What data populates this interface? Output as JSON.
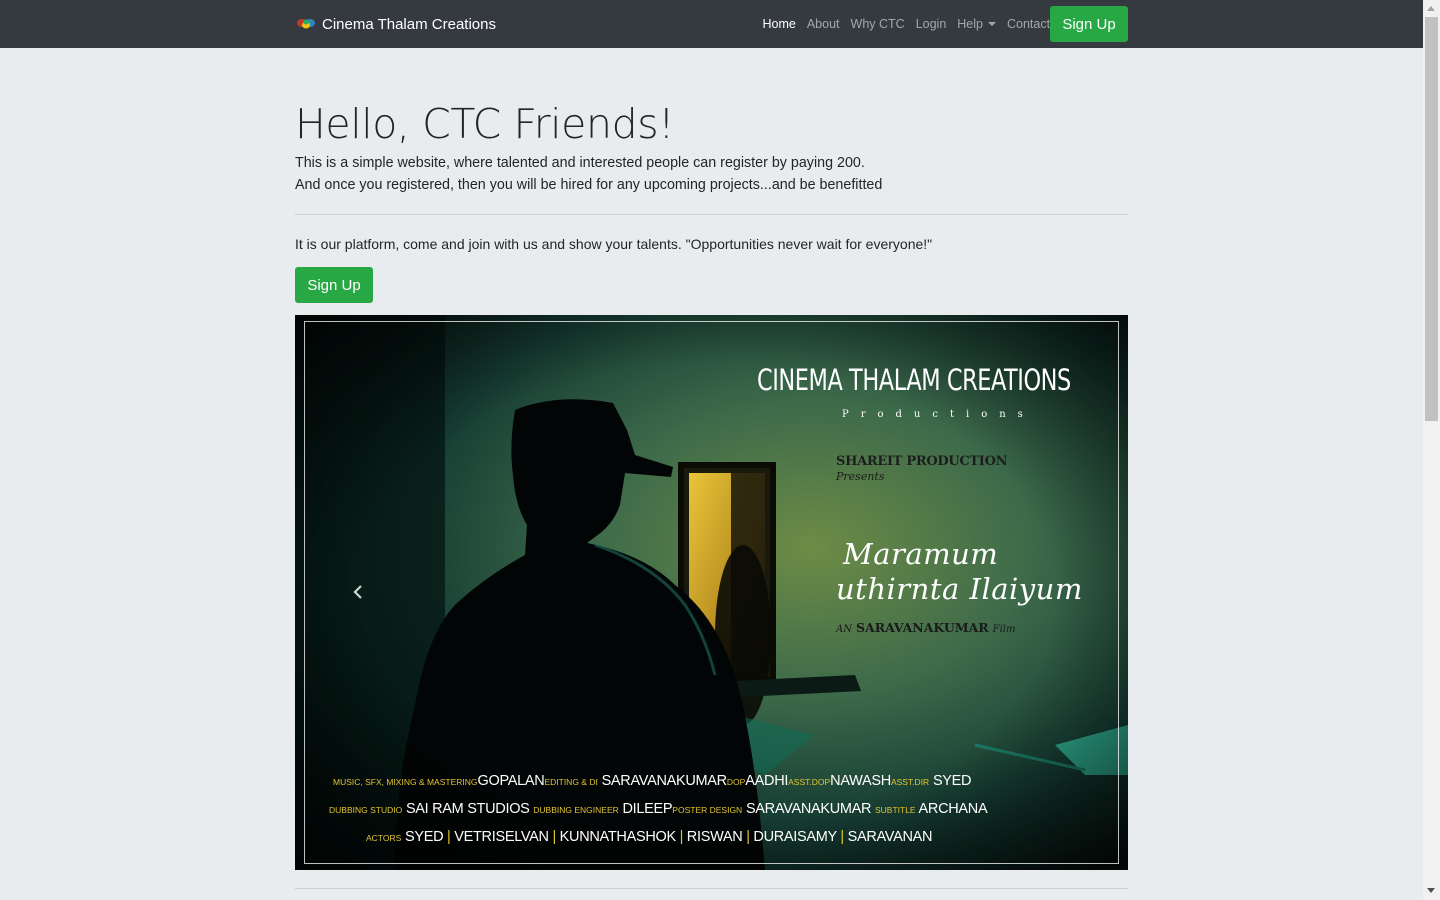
{
  "navbar": {
    "brand": "Cinema Thalam Creations",
    "links": [
      {
        "label": "Home",
        "active": true
      },
      {
        "label": "About",
        "active": false
      },
      {
        "label": "Why CTC",
        "active": false
      },
      {
        "label": "Login",
        "active": false
      },
      {
        "label": "Help",
        "active": false,
        "dropdown": true
      },
      {
        "label": "Contact",
        "active": false
      }
    ],
    "signup_label": "Sign Up",
    "bg_color": "#343a40",
    "accent_color": "#28a745"
  },
  "jumbotron": {
    "title": "Hello, CTC Friends!",
    "lead_line1": "This is a simple website, where talented and interested people can register by paying 200.",
    "lead_line2": "And once you registered, then you will be hired for any upcoming projects...and be benefitted",
    "tagline": "It is our platform, come and join with us and show your talents. \"Opportunities never wait for everyone!\"",
    "signup_label": "Sign Up"
  },
  "carousel": {
    "prev_icon": "chevron-left-icon",
    "poster": {
      "studio": "CINEMA THALAM CREATIONS",
      "productions": "Productions",
      "presenter": "SHAREIT PRODUCTION",
      "presents": "Presents",
      "film_title_line1": "Maramum",
      "film_title_line2": "uthirnta Ilaiyum",
      "director_prefix": "AN",
      "director_name": "SARAVANAKUMAR",
      "director_suffix": "Film",
      "credits": {
        "music_label": "MUSIC, SFX, MIXING & MASTERING",
        "music": "GOPALAN",
        "editing_label": "EDITING & DI",
        "editing": "SARAVANAKUMAR",
        "dop_label": "DOP",
        "dop": "AADHI",
        "asst_dop_label": "ASST.DOP",
        "asst_dop": "NAWASH",
        "asst_dir_label": "ASST.DIR",
        "asst_dir": "SYED",
        "dubbing_studio_label": "DUBBING STUDIO",
        "dubbing_studio": "SAI RAM STUDIOS",
        "dubbing_engineer_label": "DUBBING ENGINEER",
        "dubbing_engineer": "DILEEP",
        "poster_design_label": "POSTER DESIGN",
        "poster_design": "SARAVANAKUMAR",
        "subtitle_label": "SUBTITLE",
        "subtitle": "ARCHANA",
        "actors_label": "ACTORS",
        "actors": [
          "SYED",
          "VETRISELVAN",
          "KUNNATHASHOK",
          "RISWAN",
          "DURAISAMY",
          "SARAVANAN"
        ],
        "separator": "|"
      }
    }
  }
}
